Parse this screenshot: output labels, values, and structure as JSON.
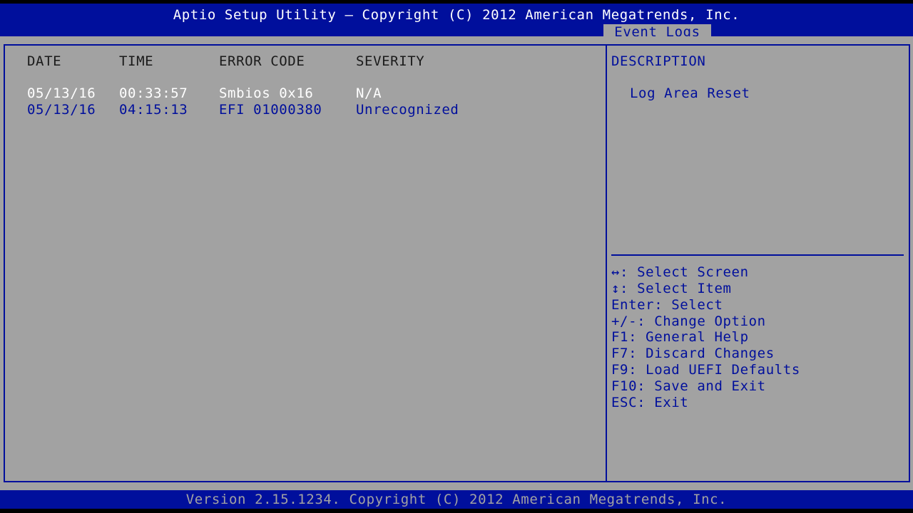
{
  "header": {
    "title": "Aptio Setup Utility – Copyright (C) 2012 American Megatrends, Inc.",
    "active_tab": "Event Logs"
  },
  "log_table": {
    "columns": [
      "DATE",
      "TIME",
      "ERROR CODE",
      "SEVERITY"
    ],
    "rows": [
      {
        "date": "05/13/16",
        "time": "00:33:57",
        "error_code": "Smbios 0x16",
        "severity": "N/A"
      },
      {
        "date": "05/13/16",
        "time": "04:15:13",
        "error_code": "EFI 01000380",
        "severity": "Unrecognized"
      }
    ]
  },
  "description": {
    "heading": "DESCRIPTION",
    "text": "Log Area Reset"
  },
  "help": {
    "items": [
      "↔: Select Screen",
      "↕: Select Item",
      "Enter: Select",
      "+/-: Change Option",
      "F1: General Help",
      "F7: Discard Changes",
      "F9: Load UEFI Defaults",
      "F10: Save and Exit",
      "ESC: Exit"
    ]
  },
  "footer": {
    "text": "Version 2.15.1234. Copyright (C) 2012 American Megatrends, Inc."
  },
  "colors": {
    "background": "#a2a2a2",
    "bar": "#000f9c",
    "text_white": "#ffffff",
    "text_blue": "#000f9c"
  }
}
